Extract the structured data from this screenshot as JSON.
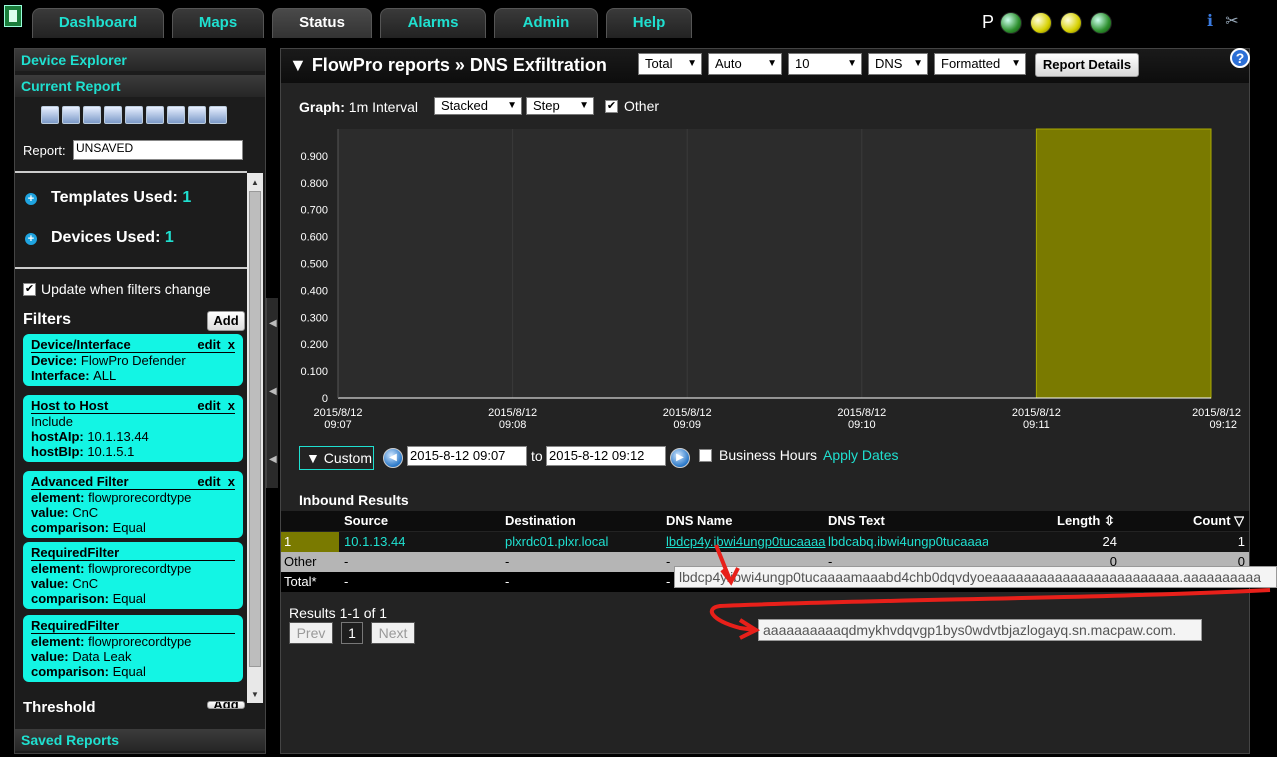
{
  "nav": {
    "tabs": [
      "Dashboard",
      "Maps",
      "Status",
      "Alarms",
      "Admin",
      "Help"
    ],
    "active": "Status",
    "status_label": "P"
  },
  "sidebar": {
    "device_explorer": "Device Explorer",
    "current_report": "Current Report",
    "report_label": "Report:",
    "report_value": "UNSAVED",
    "templates_label": "Templates Used:",
    "templates_count": "1",
    "devices_label": "Devices Used:",
    "devices_count": "1",
    "update_label": "Update when filters change",
    "filters_title": "Filters",
    "add_label": "Add",
    "edit_label": "edit",
    "remove_label": "x",
    "filters": [
      {
        "title": "Device/Interface",
        "editable": true,
        "lines": [
          [
            "Device:",
            "FlowPro Defender"
          ],
          [
            "Interface:",
            "ALL"
          ]
        ]
      },
      {
        "title": "Host to Host",
        "editable": true,
        "lines": [
          [
            "",
            "Include"
          ],
          [
            "hostAIp:",
            "10.1.13.44"
          ],
          [
            "hostBIp:",
            "10.1.5.1"
          ]
        ]
      },
      {
        "title": "Advanced Filter",
        "editable": true,
        "lines": [
          [
            "element:",
            "flowprorecordtype"
          ],
          [
            "value:",
            "CnC"
          ],
          [
            "comparison:",
            "Equal"
          ]
        ]
      },
      {
        "title": "RequiredFilter",
        "editable": false,
        "lines": [
          [
            "element:",
            "flowprorecordtype"
          ],
          [
            "value:",
            "CnC"
          ],
          [
            "comparison:",
            "Equal"
          ]
        ]
      },
      {
        "title": "RequiredFilter",
        "editable": false,
        "lines": [
          [
            "element:",
            "flowprorecordtype"
          ],
          [
            "value:",
            "Data Leak"
          ],
          [
            "comparison:",
            "Equal"
          ]
        ]
      }
    ],
    "threshold_title": "Threshold",
    "threshold_add": "Add",
    "saved_reports": "Saved Reports"
  },
  "report": {
    "title": "▼ FlowPro reports » DNS Exfiltration",
    "selects": [
      "Total",
      "Auto",
      "10",
      "DNS",
      "Formatted"
    ],
    "details_button": "Report Details",
    "graph_label": "Graph:",
    "interval": "1m Interval",
    "graph_selects": [
      "Stacked",
      "Step"
    ],
    "other_label": "Other"
  },
  "chart_data": {
    "type": "area",
    "x": [
      "2015/8/12 09:07",
      "2015/8/12 09:08",
      "2015/8/12 09:09",
      "2015/8/12 09:10",
      "2015/8/12 09:11",
      "2015/8/12 09:12"
    ],
    "x_ticks": [
      [
        "2015/8/12",
        "09:07"
      ],
      [
        "2015/8/12",
        "09:08"
      ],
      [
        "2015/8/12",
        "09:09"
      ],
      [
        "2015/8/12",
        "09:10"
      ],
      [
        "2015/8/12",
        "09:11"
      ],
      [
        "2015/8/12",
        "09:12"
      ]
    ],
    "y_ticks": [
      "0",
      "0.100",
      "0.200",
      "0.300",
      "0.400",
      "0.500",
      "0.600",
      "0.700",
      "0.800",
      "0.900"
    ],
    "ylim": [
      0,
      1.0
    ],
    "series": [
      {
        "values": [
          0,
          0,
          0,
          0,
          1.0,
          1.0
        ],
        "color": "#7a7a00"
      }
    ],
    "grid": true,
    "step": true
  },
  "dates": {
    "range_button": "▼ Custom",
    "from": "2015-8-12 09:07",
    "to_label": "to",
    "to": "2015-8-12 09:12",
    "business_hours": "Business Hours",
    "apply": "Apply Dates"
  },
  "table": {
    "title": "Inbound Results",
    "headers": [
      "Source",
      "Destination",
      "DNS Name",
      "DNS Text",
      "Length",
      "Count"
    ],
    "rows": [
      {
        "rank": "1",
        "source": "10.1.13.44",
        "destination": "plxrdc01.plxr.local",
        "dns_name": "lbdcp4y.ibwi4ungp0tucaaaa",
        "dns_text": "lbdcabq.ibwi4ungp0tucaaaa",
        "length": "24",
        "count": "1"
      },
      {
        "rank": "Other",
        "source": "-",
        "destination": "-",
        "dns_name": "-",
        "dns_text": "-",
        "length": "0",
        "count": "0"
      },
      {
        "rank": "Total*",
        "source": "-",
        "destination": "-",
        "dns_name": "-",
        "dns_text": "",
        "length": "",
        "count": ""
      }
    ],
    "results_text": "Results 1-1 of 1",
    "prev": "Prev",
    "page": "1",
    "next": "Next"
  },
  "tooltips": {
    "line1": "lbdcp4y.ibwi4ungp0tucaaaamaaabd4chb0dqvdyoeaaaaaaaaaaaaaaaaaaaaaaaa.aaaaaaaaaa",
    "line2": "aaaaaaaaaaqdmykhvdqvgp1bys0wdvtbjazlogayq.sn.macpaw.com."
  },
  "colors": {
    "accent": "#1fe0d0",
    "annotation": "#e8201a",
    "bar": "#7a7a00"
  }
}
